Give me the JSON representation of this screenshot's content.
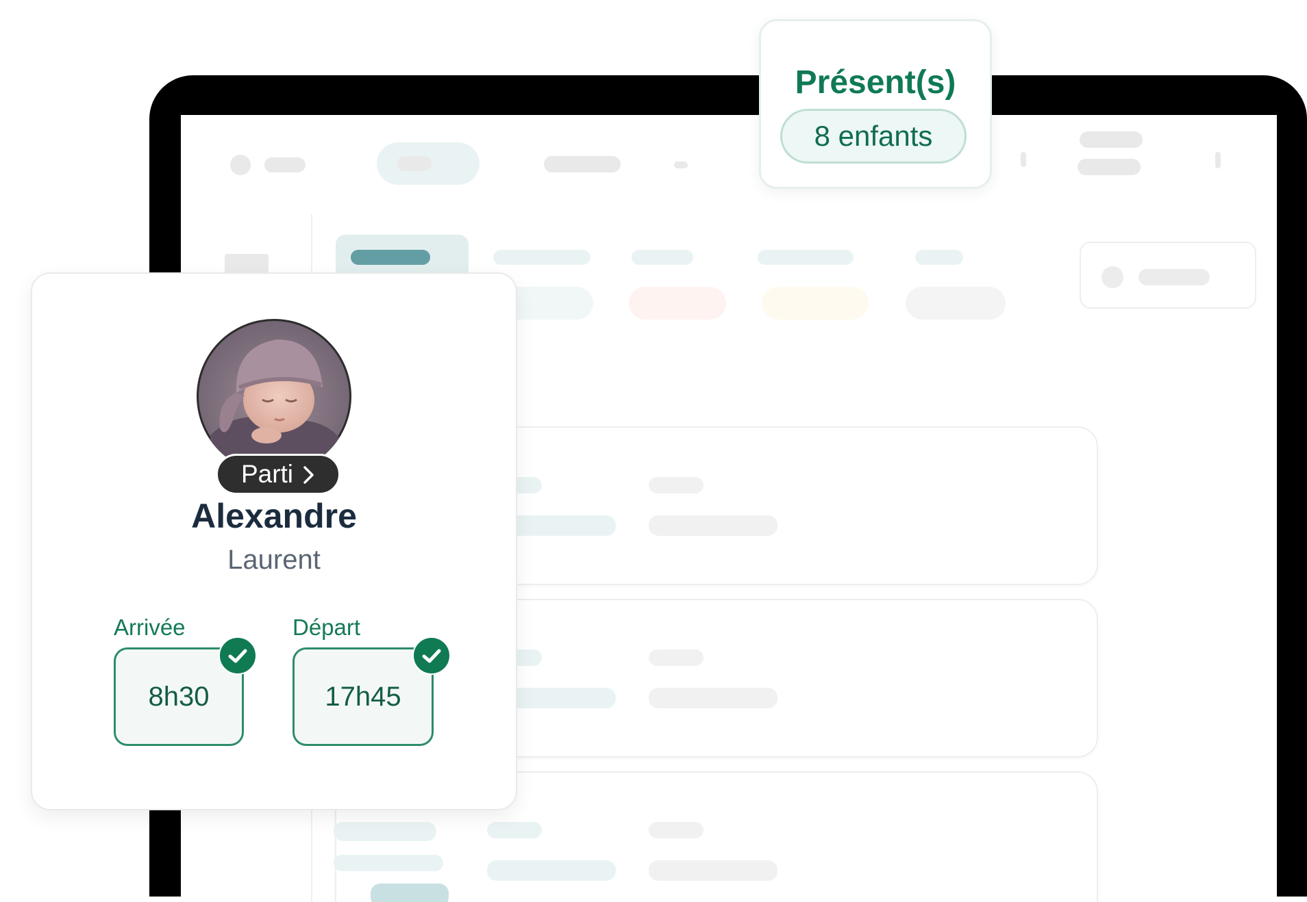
{
  "presence": {
    "title": "Présent(s)",
    "count_label": "8 enfants"
  },
  "child_card": {
    "status": "Parti",
    "first_name": "Alexandre",
    "last_name": "Laurent",
    "arrival": {
      "label": "Arrivée",
      "time": "8h30",
      "checked": true
    },
    "departure": {
      "label": "Départ",
      "time": "17h45",
      "checked": true
    }
  },
  "icons": {
    "status_chevron": "chevron-right-icon",
    "arrival_check": "check-icon",
    "departure_check": "check-icon"
  },
  "colors": {
    "accent": "#0f7a55",
    "name": "#1c2c3f",
    "frame": "#000000",
    "badge": "#2e2e2e"
  }
}
